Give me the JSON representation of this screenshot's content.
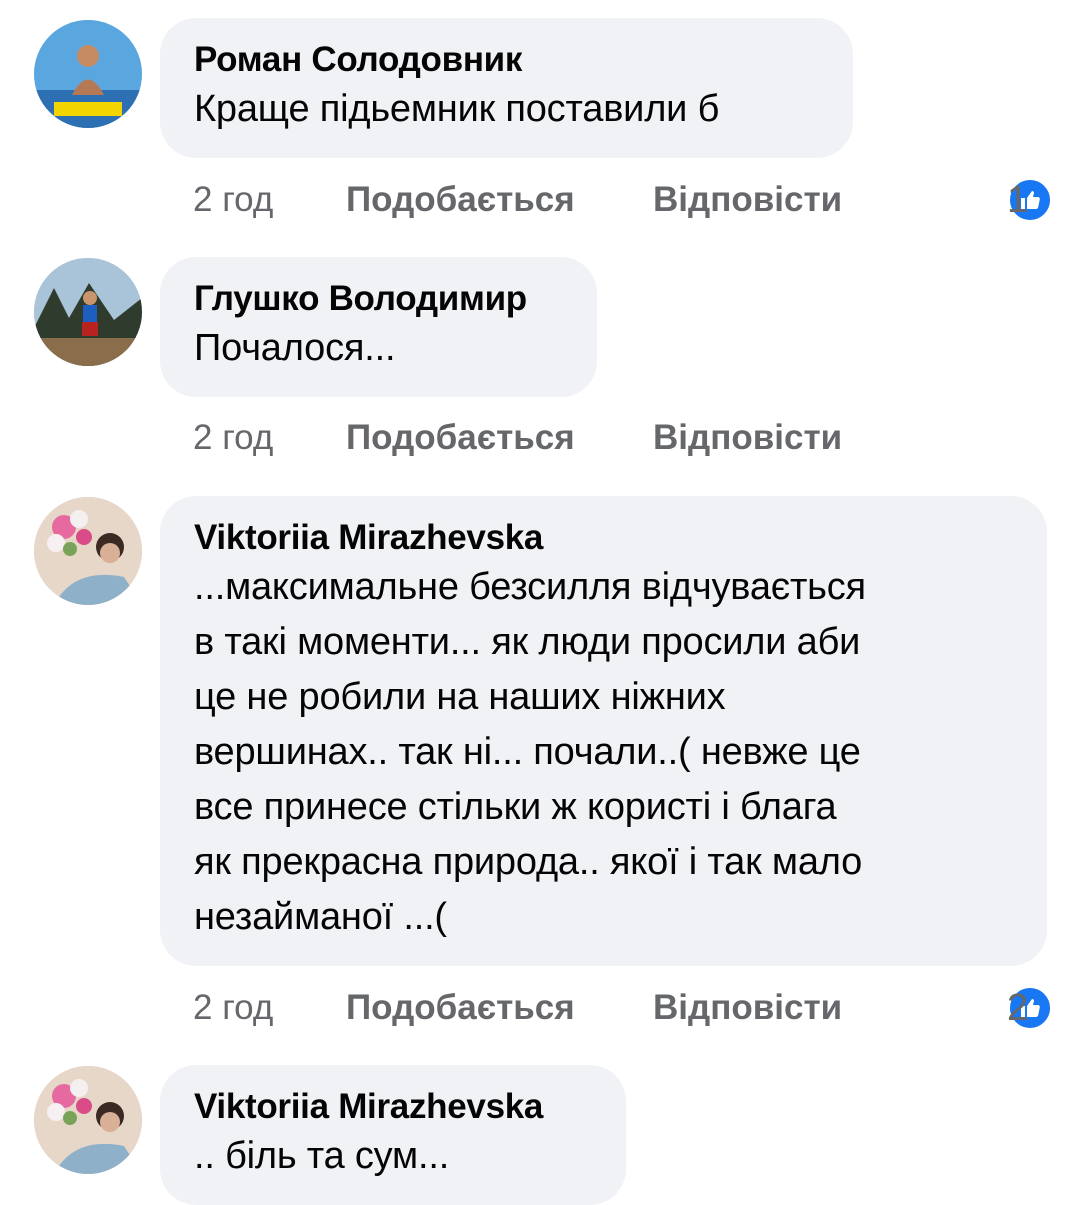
{
  "comments": [
    {
      "author": "Роман Солодовник",
      "text": "Краще підьемник поставили б",
      "time": "2 год",
      "like_label": "Подобається",
      "reply_label": "Відповісти",
      "reaction_count": "1",
      "avatar_icon": "user-avatar-icon"
    },
    {
      "author": "Глушко Володимир",
      "text": "Почалося...",
      "time": "2 год",
      "like_label": "Подобається",
      "reply_label": "Відповісти",
      "reaction_count": "",
      "avatar_icon": "user-avatar-icon"
    },
    {
      "author": "Viktoriia Mirazhevska",
      "text": "...максимальне безсилля відчувається\nв такі моменти... як люди просили аби\nце не робили на наших ніжних\nвершинах.. так ні... почали..( невже це\nвсе принесе стільки ж користі і блага\nяк прекрасна природа.. якої і так мало\nнезайманої ...(",
      "time": "2 год",
      "like_label": "Подобається",
      "reply_label": "Відповісти",
      "reaction_count": "2",
      "avatar_icon": "user-avatar-icon"
    },
    {
      "author": "Viktoriia Mirazhevska",
      "text": ".. біль та сум...",
      "avatar_icon": "user-avatar-icon"
    }
  ],
  "colors": {
    "bubble_bg": "#f0f2f5",
    "meta_text": "#65676b",
    "like_blue": "#1877f2"
  }
}
